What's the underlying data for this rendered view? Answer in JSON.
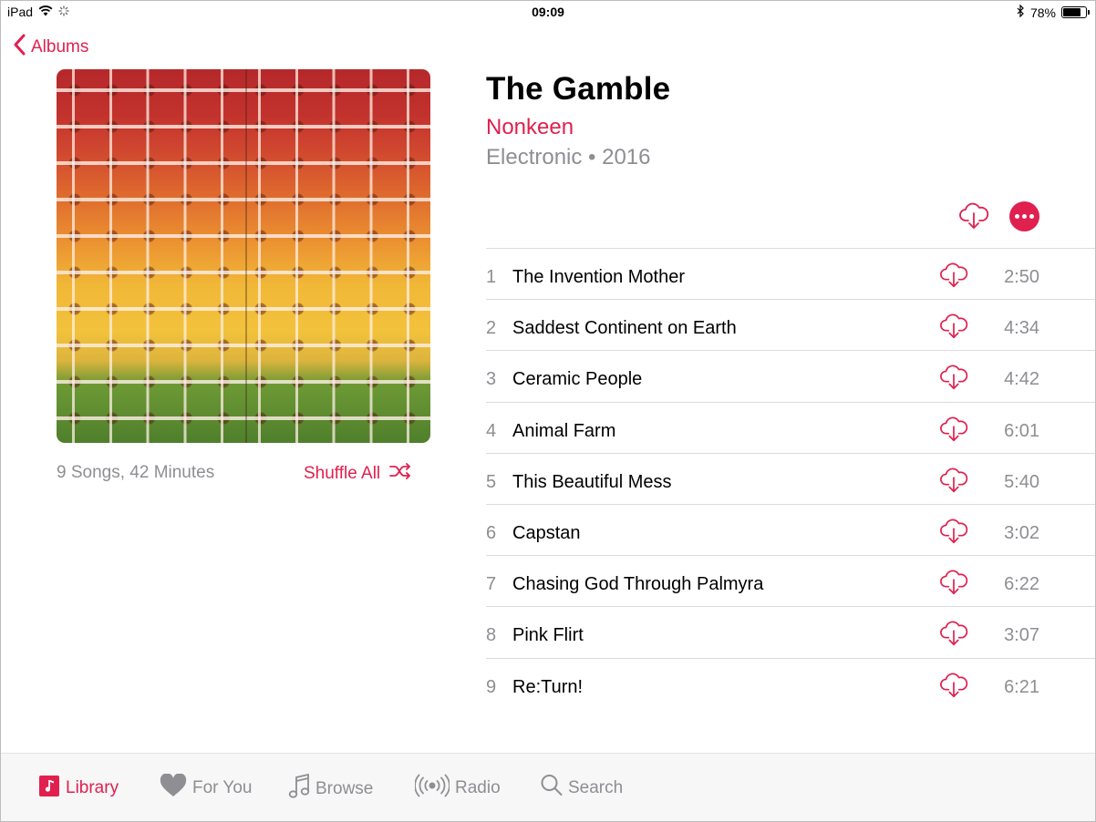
{
  "status_bar": {
    "device": "iPad",
    "time": "09:09",
    "battery": "78%",
    "battery_level": 0.78
  },
  "nav": {
    "back_label": "Albums"
  },
  "album": {
    "title": "The Gamble",
    "artist": "Nonkeen",
    "genre_year": "Electronic • 2016",
    "summary": "9 Songs, 42 Minutes",
    "shuffle_label": "Shuffle All"
  },
  "tracks": [
    {
      "num": "1",
      "title": "The Invention Mother",
      "duration": "2:50"
    },
    {
      "num": "2",
      "title": "Saddest Continent on Earth",
      "duration": "4:34"
    },
    {
      "num": "3",
      "title": "Ceramic People",
      "duration": "4:42"
    },
    {
      "num": "4",
      "title": "Animal Farm",
      "duration": "6:01"
    },
    {
      "num": "5",
      "title": "This Beautiful Mess",
      "duration": "5:40"
    },
    {
      "num": "6",
      "title": "Capstan",
      "duration": "3:02"
    },
    {
      "num": "7",
      "title": "Chasing God Through Palmyra",
      "duration": "6:22"
    },
    {
      "num": "8",
      "title": "Pink Flirt",
      "duration": "3:07"
    },
    {
      "num": "9",
      "title": "Re:Turn!",
      "duration": "6:21"
    }
  ],
  "tabs": [
    {
      "label": "Library",
      "icon": "library-icon",
      "active": true
    },
    {
      "label": "For You",
      "icon": "heart-icon",
      "active": false
    },
    {
      "label": "Browse",
      "icon": "music-note-icon",
      "active": false
    },
    {
      "label": "Radio",
      "icon": "radio-icon",
      "active": false
    },
    {
      "label": "Search",
      "icon": "search-icon",
      "active": false
    }
  ],
  "colors": {
    "accent": "#e0204f",
    "secondary_text": "#8e8e93"
  }
}
